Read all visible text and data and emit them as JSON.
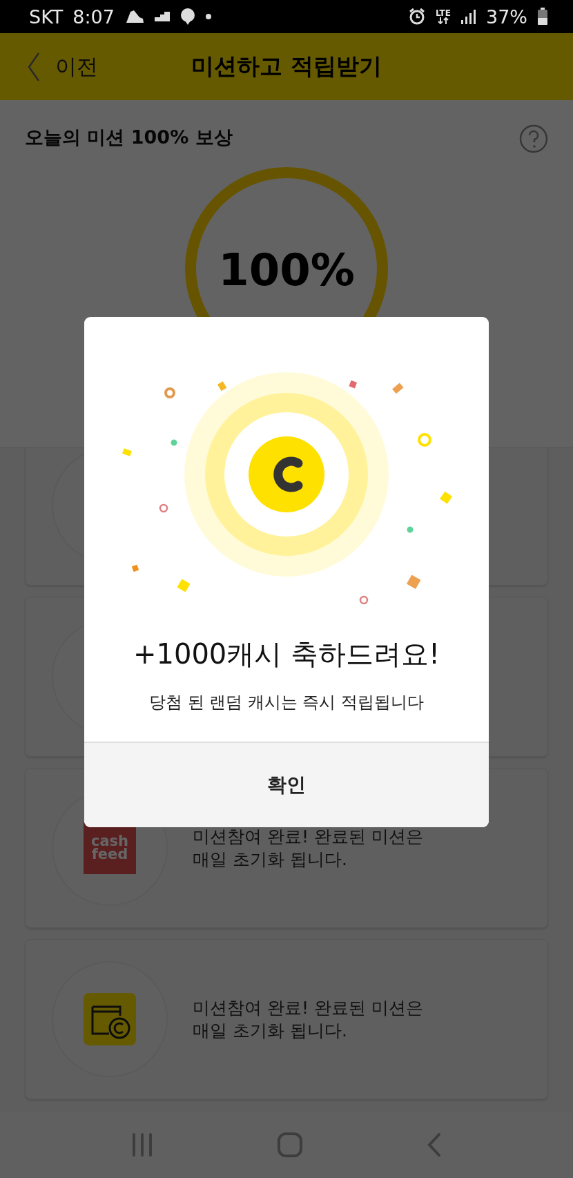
{
  "status_bar": {
    "carrier": "SKT",
    "time": "8:07",
    "network": "LTE",
    "battery": "37%"
  },
  "header": {
    "back_label": "이전",
    "title": "미션하고 적립받기"
  },
  "reward_summary": {
    "title": "오늘의 미션 100% 보상",
    "percent": "100%"
  },
  "mission_cards": [
    {
      "kind": "covered"
    },
    {
      "kind": "covered"
    },
    {
      "kind": "cashfeed",
      "logo_lines": [
        "cash",
        "feed"
      ],
      "lines": [
        "미션참여 완료!  완료된 미션은",
        "매일 초기화 됩니다."
      ]
    },
    {
      "kind": "wallet",
      "lines": [
        "미션참여 완료!  완료된 미션은",
        "매일 초기화 됩니다."
      ]
    }
  ],
  "dialog": {
    "title": "+1000캐시 축하드려요!",
    "message": "당첨 된 랜덤 캐시는 즉시 적립됩니다",
    "confirm": "확인"
  }
}
